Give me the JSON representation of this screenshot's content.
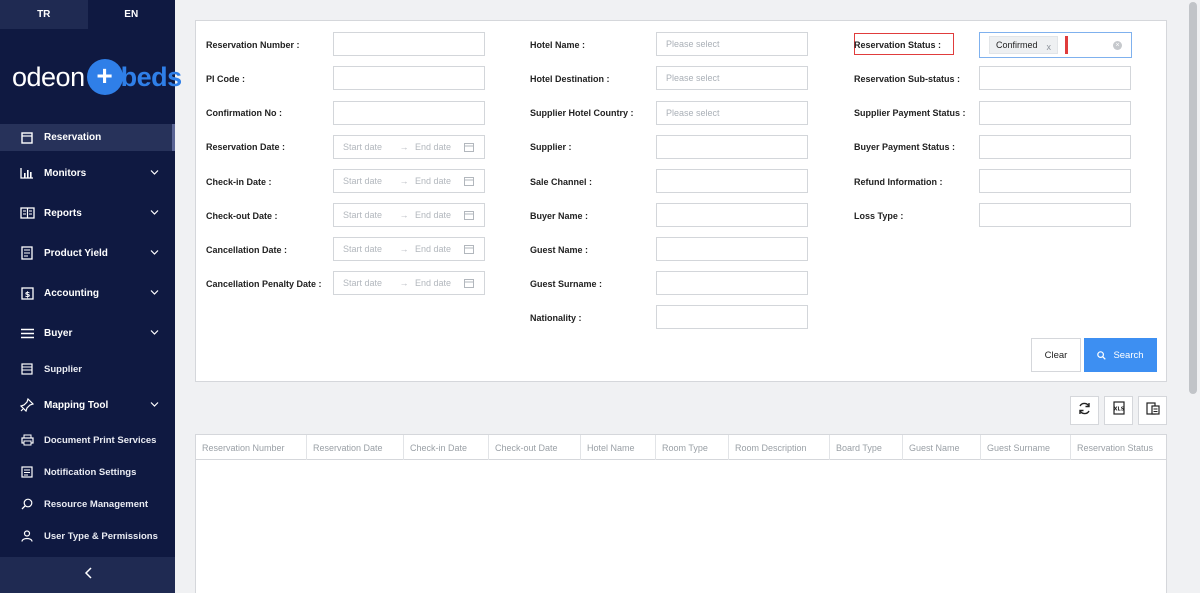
{
  "lang": {
    "tr": "TR",
    "en": "EN"
  },
  "logo": {
    "part1": "odeon",
    "plus": "+",
    "part2": "beds"
  },
  "nav": {
    "reservation": "Reservation",
    "monitors": "Monitors",
    "reports": "Reports",
    "product_yield": "Product Yield",
    "accounting": "Accounting",
    "buyer": "Buyer",
    "supplier": "Supplier",
    "mapping_tool": "Mapping Tool",
    "document_print": "Document Print Services",
    "notification_settings": "Notification Settings",
    "resource_management": "Resource Management",
    "user_type": "User Type & Permissions"
  },
  "filters": {
    "col1": {
      "reservation_number": "Reservation Number :",
      "pi_code": "PI Code :",
      "confirmation_no": "Confirmation No :",
      "reservation_date": "Reservation Date :",
      "checkin_date": "Check-in Date :",
      "checkout_date": "Check-out Date :",
      "cancellation_date": "Cancellation Date :",
      "cancellation_penalty_date": "Cancellation Penalty Date :"
    },
    "col2": {
      "hotel_name": "Hotel Name :",
      "hotel_destination": "Hotel Destination :",
      "supplier_hotel_country": "Supplier Hotel Country :",
      "supplier": "Supplier :",
      "sale_channel": "Sale Channel :",
      "buyer_name": "Buyer Name :",
      "guest_name": "Guest Name :",
      "guest_surname": "Guest Surname :",
      "nationality": "Nationality :"
    },
    "col3": {
      "reservation_status": "Reservation Status :",
      "reservation_substatus": "Reservation Sub-status :",
      "supplier_payment_status": "Supplier Payment Status :",
      "buyer_payment_status": "Buyer Payment Status :",
      "refund_information": "Refund Information :",
      "loss_type": "Loss Type :"
    },
    "placeholders": {
      "please_select": "Please select",
      "start_date": "Start date",
      "end_date": "End date"
    },
    "status_tag": "Confirmed",
    "tag_remove": "x"
  },
  "buttons": {
    "clear": "Clear",
    "search": "Search"
  },
  "table": {
    "columns": [
      "Reservation Number",
      "Reservation Date",
      "Check-in Date",
      "Check-out Date",
      "Hotel Name",
      "Room Type",
      "Room Description",
      "Board Type",
      "Guest Name",
      "Guest Surname",
      "Reservation Status"
    ]
  },
  "colors": {
    "sidebar": "#0f1941",
    "accent": "#3d8ff2",
    "highlight": "#e03c3c"
  },
  "icons": {
    "refresh": "refresh-icon",
    "excel": "excel-export-icon",
    "columns": "column-settings-icon"
  }
}
